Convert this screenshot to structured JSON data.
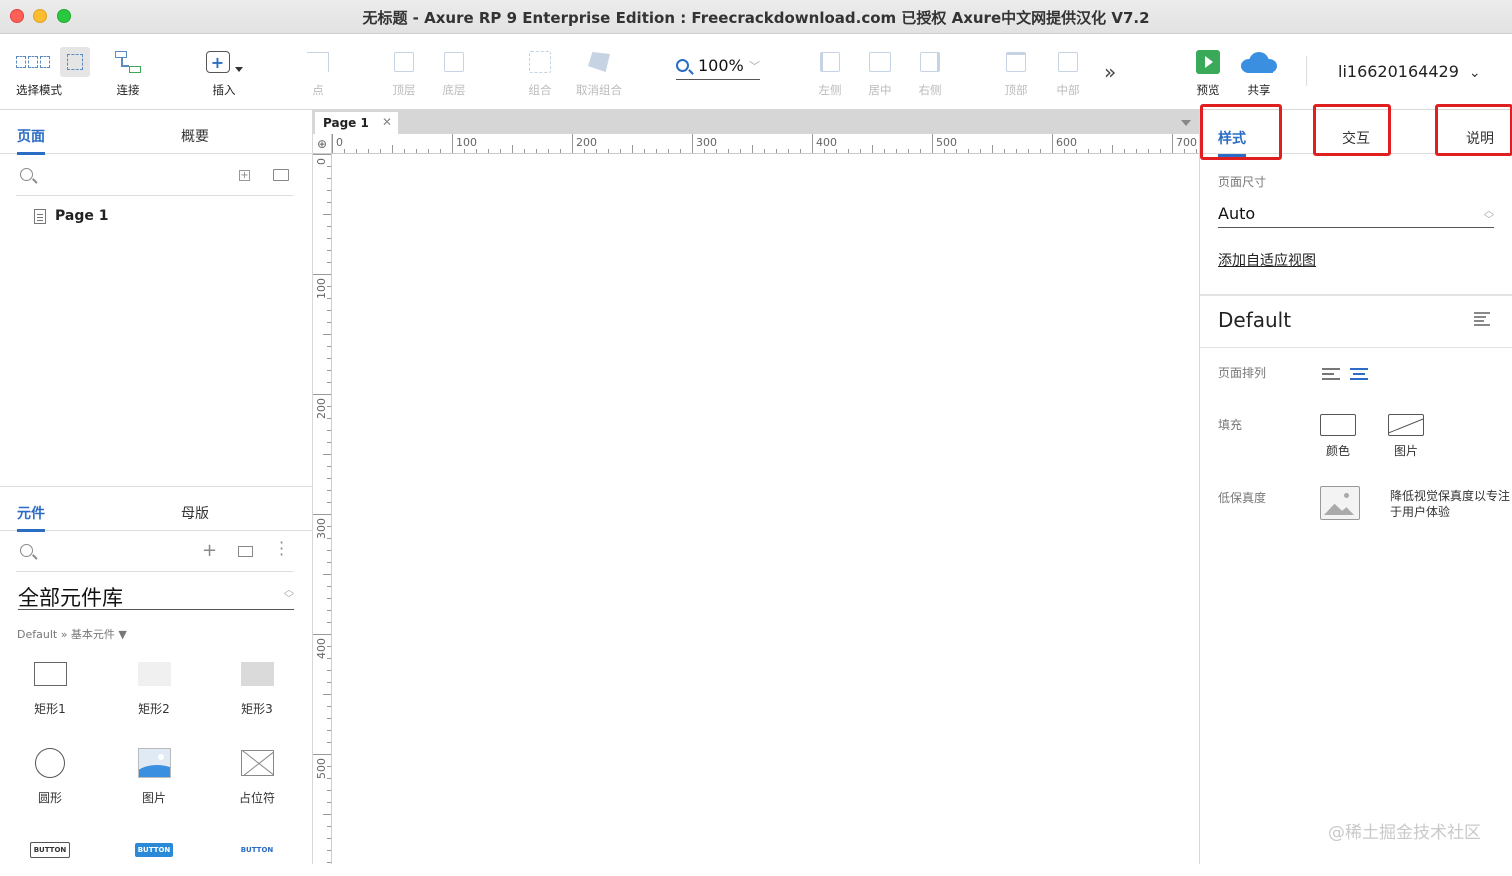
{
  "window": {
    "title": "无标题 - Axure RP 9 Enterprise Edition : Freecrackdownload.com 已授权      Axure中文网提供汉化 V7.2"
  },
  "toolbar": {
    "select_mode": "选择模式",
    "connect": "连接",
    "insert": "插入",
    "point": "点",
    "top_layer": "顶层",
    "bottom_layer": "底层",
    "group": "组合",
    "ungroup": "取消组合",
    "zoom": "100%",
    "align_left": "左侧",
    "align_center": "居中",
    "align_right": "右侧",
    "align_top": "顶部",
    "align_middle": "中部",
    "preview": "预览",
    "share": "共享",
    "user": "li16620164429"
  },
  "left_panel": {
    "tabs": [
      "页面",
      "概要"
    ],
    "pages": [
      {
        "label": "Page 1"
      }
    ],
    "lib_tabs": [
      "元件",
      "母版"
    ],
    "library": "全部元件库",
    "breadcrumb": "Default » 基本元件 ▼",
    "widgets": [
      {
        "label": "矩形1"
      },
      {
        "label": "矩形2"
      },
      {
        "label": "矩形3"
      },
      {
        "label": "圆形"
      },
      {
        "label": "图片"
      },
      {
        "label": "占位符"
      },
      {
        "label": "BUTTON"
      },
      {
        "label": "BUTTON"
      },
      {
        "label": "BUTTON"
      }
    ]
  },
  "canvas": {
    "page_tab": "Page 1",
    "h_ruler": [
      "0",
      "100",
      "200",
      "300",
      "400",
      "500",
      "600",
      "700"
    ],
    "v_ruler": [
      "0",
      "100",
      "200",
      "300",
      "400",
      "500"
    ]
  },
  "right_panel": {
    "tabs": [
      "样式",
      "交互",
      "说明"
    ],
    "page_size_label": "页面尺寸",
    "page_size_value": "Auto",
    "add_adaptive": "添加自适应视图",
    "style_name": "Default",
    "page_align_label": "页面排列",
    "fill_label": "填充",
    "fill_color": "颜色",
    "fill_image": "图片",
    "lofi_label": "低保真度",
    "lofi_desc": "降低视觉保真度以专注于用户体验"
  },
  "watermark": "@稀土掘金技术社区",
  "colors": {
    "accent": "#2b6cc4",
    "highlight": "#e02020"
  }
}
